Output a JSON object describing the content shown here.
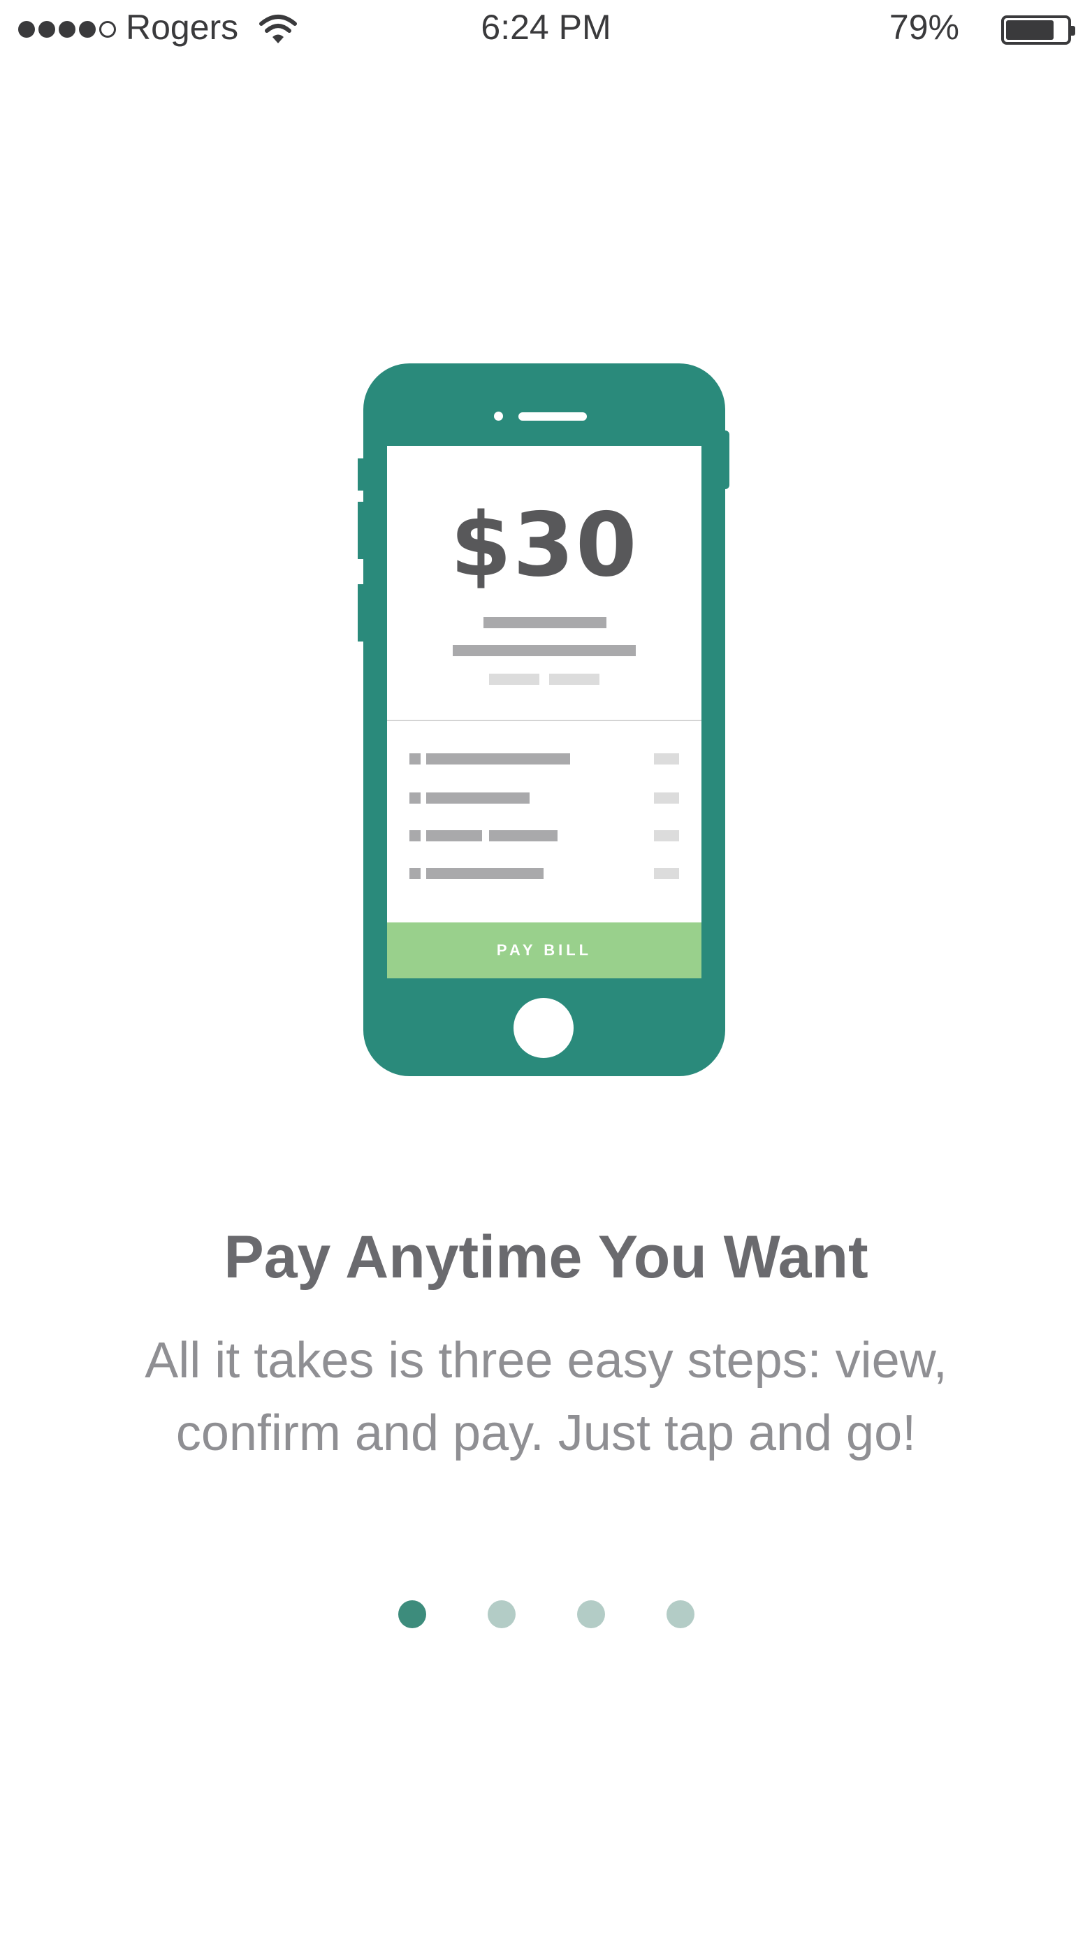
{
  "status_bar": {
    "carrier": "Rogers",
    "time": "6:24 PM",
    "battery_percent": "79%",
    "battery_level": 0.79,
    "signal_bars_filled": 4,
    "signal_bars_total": 5
  },
  "illustration": {
    "amount": "$30",
    "pay_button_label": "PAY BILL",
    "colors": {
      "phone_body": "#2a8a7b",
      "pay_button": "#99d08c"
    }
  },
  "onboarding": {
    "title": "Pay Anytime You Want",
    "description": "All it takes is three easy steps: view, confirm and pay. Just tap and go!"
  },
  "pagination": {
    "pages": 4,
    "current_index": 0,
    "active_color": "#3d8c7c",
    "inactive_color": "#b3ccc6"
  }
}
